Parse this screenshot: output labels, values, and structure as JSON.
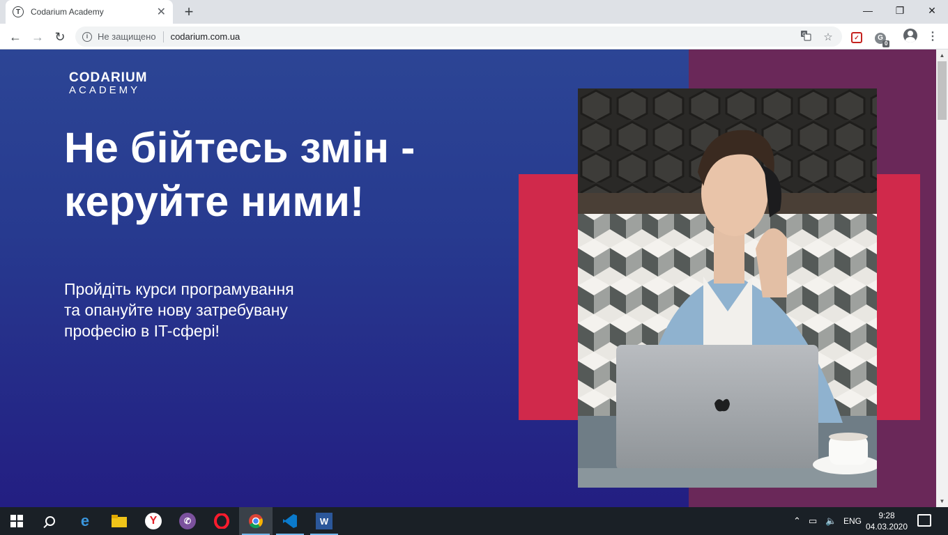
{
  "browser": {
    "tab_title": "Codarium Academy",
    "tab_favicon": "T",
    "close_glyph": "✕",
    "newtab_glyph": "+",
    "window_controls": {
      "minimize": "—",
      "maximize": "❐",
      "close": "✕"
    },
    "nav": {
      "back": "←",
      "forward": "→",
      "reload": "↻"
    },
    "security_label": "Не защищено",
    "url": "codarium.com.ua",
    "extension_badge": "0",
    "menu_glyph": "⋮",
    "icons": [
      "info-icon",
      "translate-icon",
      "star-icon",
      "pocket-icon",
      "ghostery-icon",
      "profile-icon",
      "menu-icon"
    ]
  },
  "page": {
    "logo_top": "CODARIUM",
    "logo_bottom": "ACADEMY",
    "headline_line1": "Не бійтесь змін -",
    "headline_line2": "керуйте ними!",
    "subtext_line1": "Пройдіть курси програмування",
    "subtext_line2": "та опануйте нову затребувану",
    "subtext_line3": "професію в IT-сфері!",
    "colors": {
      "left_bg": "#2c4595",
      "right_band": "#6a2859",
      "accent_red": "#d0294b"
    }
  },
  "taskbar": {
    "apps": [
      "start",
      "search",
      "edge",
      "file-explorer",
      "yandex-browser",
      "viber",
      "opera",
      "chrome",
      "vscode",
      "word"
    ],
    "language": "ENG",
    "time": "9:28",
    "date": "04.03.2020"
  }
}
